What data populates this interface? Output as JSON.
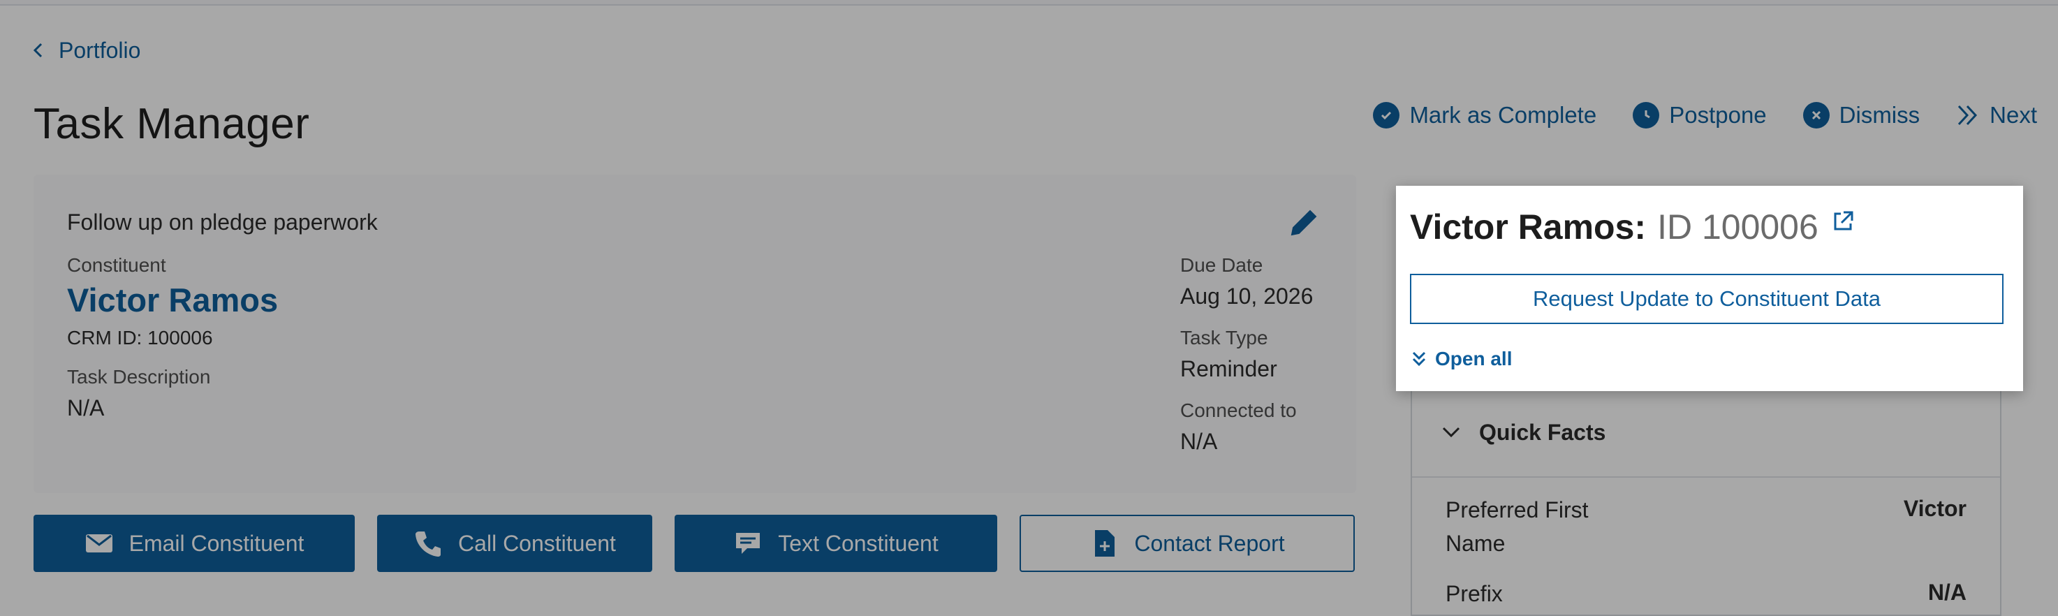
{
  "breadcrumb": {
    "back_label": "Portfolio"
  },
  "page": {
    "title": "Task Manager"
  },
  "actions": {
    "complete": "Mark as Complete",
    "postpone": "Postpone",
    "dismiss": "Dismiss",
    "next": "Next"
  },
  "task": {
    "subject": "Follow up on pledge paperwork",
    "constituent_label": "Constituent",
    "constituent_name": "Victor Ramos",
    "crm_id": "CRM ID: 100006",
    "description_label": "Task Description",
    "description_value": "N/A",
    "due_label": "Due Date",
    "due_value": "Aug 10, 2026",
    "type_label": "Task Type",
    "type_value": "Reminder",
    "connected_label": "Connected to",
    "connected_value": "N/A"
  },
  "buttons": {
    "email": "Email Constituent",
    "call": "Call Constituent",
    "text": "Text Constituent",
    "report": "Contact Report"
  },
  "popover": {
    "name": "Victor Ramos:",
    "id": "ID 100006",
    "request_label": "Request Update to Constituent Data",
    "open_all": "Open all"
  },
  "quick_facts": {
    "title": "Quick Facts",
    "rows": [
      {
        "label": "Preferred First Name",
        "value": "Victor"
      },
      {
        "label": "Prefix",
        "value": "N/A"
      }
    ]
  },
  "colors": {
    "accent": "#0f5e9c",
    "overlay": "rgba(0,0,0,0.34)"
  }
}
